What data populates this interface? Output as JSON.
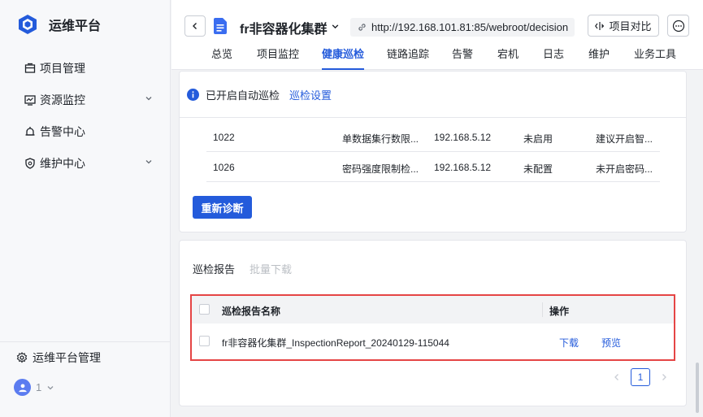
{
  "app": {
    "title": "运维平台"
  },
  "sidebar": {
    "items": [
      {
        "label": "项目管理",
        "icon": "project-icon"
      },
      {
        "label": "资源监控",
        "icon": "monitor-icon",
        "expandable": true
      },
      {
        "label": "告警中心",
        "icon": "alarm-bell-icon"
      },
      {
        "label": "维护中心",
        "icon": "shield-icon",
        "expandable": true
      }
    ],
    "bottom_label": "运维平台管理",
    "user_name": "1"
  },
  "header": {
    "project_title": "fr非容器化集群",
    "url": "http://192.168.101.81:85/webroot/decision",
    "compare_label": "项目对比",
    "tabs": [
      {
        "label": "总览"
      },
      {
        "label": "项目监控"
      },
      {
        "label": "健康巡检",
        "active": true
      },
      {
        "label": "链路追踪"
      },
      {
        "label": "告警"
      },
      {
        "label": "宕机"
      },
      {
        "label": "日志"
      },
      {
        "label": "维护"
      },
      {
        "label": "业务工具"
      }
    ]
  },
  "notice": {
    "text": "已开启自动巡检",
    "link": "巡检设置"
  },
  "diagnosis": {
    "rows": [
      {
        "id": "1022",
        "name": "单数据集行数限...",
        "ip": "192.168.5.12",
        "status": "未启用",
        "advice": "建议开启智..."
      },
      {
        "id": "1026",
        "name": "密码强度限制检...",
        "ip": "192.168.5.12",
        "status": "未配置",
        "advice": "未开启密码..."
      }
    ],
    "rediagnose_label": "重新诊断"
  },
  "reports": {
    "tab_active": "巡检报告",
    "tab_disabled": "批量下载",
    "columns": {
      "name": "巡检报告名称",
      "ops": "操作"
    },
    "rows": [
      {
        "name": "fr非容器化集群_InspectionReport_20240129-115044",
        "download": "下载",
        "preview": "预览"
      }
    ],
    "page": "1"
  },
  "colors": {
    "accent": "#245bdb",
    "highlight": "#e54545"
  }
}
